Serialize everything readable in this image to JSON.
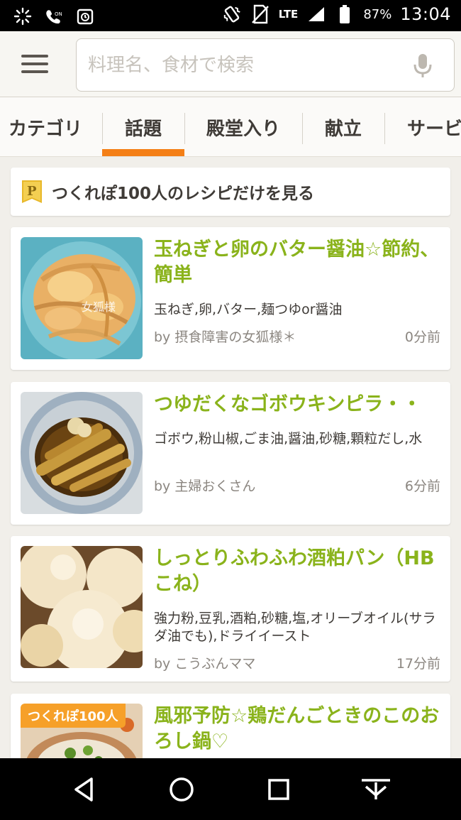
{
  "status_bar": {
    "battery_percent": "87%",
    "network": "LTE",
    "time": "13:04"
  },
  "header": {
    "search_placeholder": "料理名、食材で検索"
  },
  "tabs": [
    {
      "label": "カテゴリ"
    },
    {
      "label": "話題"
    },
    {
      "label": "殿堂入り"
    },
    {
      "label": "献立"
    },
    {
      "label": "サービ"
    }
  ],
  "active_tab": "話題",
  "filter": {
    "badge_letter": "P",
    "label": "つくれぽ100人のレシピだけを見る"
  },
  "recipes": [
    {
      "title": "玉ねぎと卵のバター醤油☆節約、簡単",
      "ingredients": "玉ねぎ,卵,バター,麺つゆor醤油",
      "author": "by 摂食障害の女狐様＊",
      "time": "0分前",
      "watermark": "女狐様"
    },
    {
      "title": "つゆだくなゴボウキンピラ・・",
      "ingredients": "ゴボウ,粉山椒,ごま油,醤油,砂糖,顆粒だし,水",
      "author": "by 主婦おくさん",
      "time": "6分前"
    },
    {
      "title": "しっとりふわふわ酒粕パン（HBこね）",
      "ingredients": "強力粉,豆乳,酒粕,砂糖,塩,オリーブオイル(サラダ油でも),ドライイースト",
      "author": "by こうぶんママ",
      "time": "17分前"
    },
    {
      "badge": "つくれぽ100人",
      "title": "風邪予防☆鶏だんごときのこのおろし鍋♡"
    }
  ],
  "colors": {
    "accent_orange": "#f47f16",
    "title_green": "#8ab31b",
    "badge_orange": "#f6a029"
  }
}
